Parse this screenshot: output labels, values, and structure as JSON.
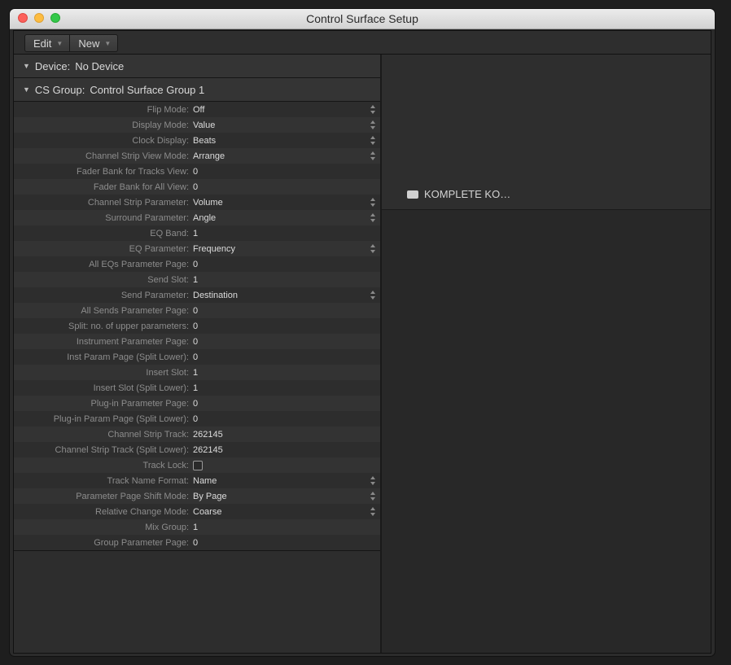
{
  "window": {
    "title": "Control Surface Setup"
  },
  "toolbar": {
    "edit_label": "Edit",
    "new_label": "New"
  },
  "device_section": {
    "label": "Device:",
    "value": "No Device"
  },
  "group_section": {
    "label": "CS Group:",
    "value": "Control Surface Group 1"
  },
  "params": [
    {
      "label": "Flip Mode:",
      "value": "Off",
      "control": "popup"
    },
    {
      "label": "Display Mode:",
      "value": "Value",
      "control": "popup"
    },
    {
      "label": "Clock Display:",
      "value": "Beats",
      "control": "popup"
    },
    {
      "label": "Channel Strip View Mode:",
      "value": "Arrange",
      "control": "popup"
    },
    {
      "label": "Fader Bank for Tracks View:",
      "value": "0",
      "control": "number"
    },
    {
      "label": "Fader Bank for All View:",
      "value": "0",
      "control": "number"
    },
    {
      "label": "Channel Strip Parameter:",
      "value": "Volume",
      "control": "popup"
    },
    {
      "label": "Surround Parameter:",
      "value": "Angle",
      "control": "popup"
    },
    {
      "label": "EQ Band:",
      "value": "1",
      "control": "number"
    },
    {
      "label": "EQ Parameter:",
      "value": "Frequency",
      "control": "popup"
    },
    {
      "label": "All EQs Parameter Page:",
      "value": "0",
      "control": "number"
    },
    {
      "label": "Send Slot:",
      "value": "1",
      "control": "number"
    },
    {
      "label": "Send Parameter:",
      "value": "Destination",
      "control": "popup"
    },
    {
      "label": "All Sends Parameter Page:",
      "value": "0",
      "control": "number"
    },
    {
      "label": "Split: no. of upper parameters:",
      "value": "0",
      "control": "number"
    },
    {
      "label": "Instrument Parameter Page:",
      "value": "0",
      "control": "number"
    },
    {
      "label": "Inst Param Page (Split Lower):",
      "value": "0",
      "control": "number"
    },
    {
      "label": "Insert Slot:",
      "value": "1",
      "control": "number"
    },
    {
      "label": "Insert Slot (Split Lower):",
      "value": "1",
      "control": "number"
    },
    {
      "label": "Plug-in Parameter Page:",
      "value": "0",
      "control": "number"
    },
    {
      "label": "Plug-in Param Page (Split Lower):",
      "value": "0",
      "control": "number"
    },
    {
      "label": "Channel Strip Track:",
      "value": "262145",
      "control": "number"
    },
    {
      "label": "Channel Strip Track (Split Lower):",
      "value": "262145",
      "control": "number"
    },
    {
      "label": "Track Lock:",
      "value": "",
      "control": "checkbox"
    },
    {
      "label": "Track Name Format:",
      "value": "Name",
      "control": "popup"
    },
    {
      "label": "Parameter Page Shift Mode:",
      "value": "By Page",
      "control": "popup"
    },
    {
      "label": "Relative Change Mode:",
      "value": "Coarse",
      "control": "popup"
    },
    {
      "label": "Mix Group:",
      "value": "1",
      "control": "number"
    },
    {
      "label": "Group Parameter Page:",
      "value": "0",
      "control": "number"
    }
  ],
  "devices": [
    {
      "label": "KOMPLETE KO…",
      "icon": "device-icon"
    }
  ]
}
